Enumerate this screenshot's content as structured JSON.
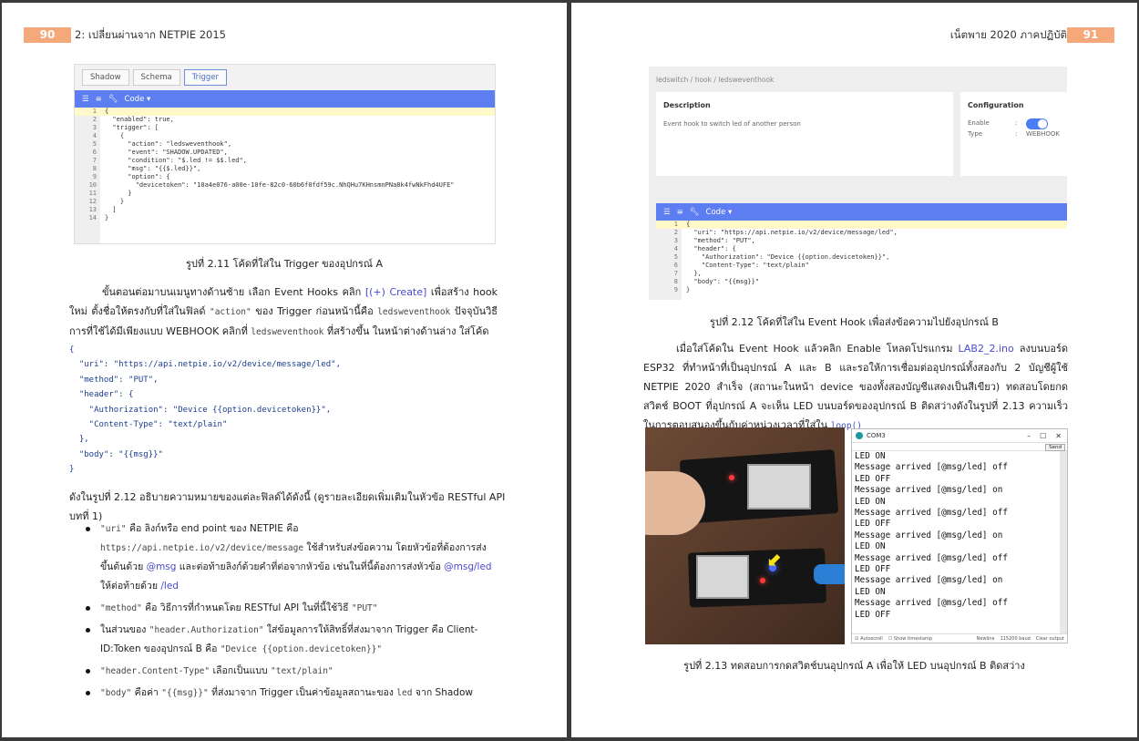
{
  "left": {
    "page_number": "90",
    "header": "2: เปลี่ยนผ่านจาก NETPIE 2015",
    "figure1": {
      "tabs": [
        "Shadow",
        "Schema",
        "Trigger"
      ],
      "toolbar_label": "Code ▾",
      "code_lines": [
        "{",
        "  \"enabled\": true,",
        "  \"trigger\": [",
        "    {",
        "      \"action\": \"ledsweventhook\",",
        "      \"event\": \"SHADOW.UPDATED\",",
        "      \"condition\": \"$.led != $$.led\",",
        "      \"msg\": \"{{$.led}}\",",
        "      \"option\": {",
        "        \"devicetoken\": \"10a4e076-a00e-10fe-82c0-60b6f0fdf59c.NhQHu7KHnsmnPNa8k4fwNkFhd4UFE\"",
        "      }",
        "    }",
        "  ]",
        "}"
      ],
      "caption": "รูปที่ 2.11 โค้ดที่ใส่ใน Trigger ของอุปกรณ์ A"
    },
    "para1": {
      "t1": "ขั้นตอนต่อมาบนเมนูทางด้านซ้าย เลือก Event Hooks คลิก ",
      "t2": "[(+) Create]",
      "t3": " เพื่อสร้าง hook ใหม่ ตั้งชื่อให้ตรงกับที่ใส่ในฟิลด์ ",
      "c1": "\"action\"",
      "t4": " ของ Trigger ก่อนหน้านี้คือ ",
      "c2": "ledsweventhook",
      "t5": " ปัจจุบันวิธีการที่ใช้ได้มีเพียงแบบ WEBHOOK คลิกที่ ",
      "c3": "ledsweventhook",
      "t6": " ที่สร้างขึ้น ในหน้าต่างด้านล่าง ใส่โค้ด"
    },
    "code_block": "{\n  \"uri\": \"https://api.netpie.io/v2/device/message/led\",\n  \"method\": \"PUT\",\n  \"header\": {\n    \"Authorization\": \"Device {{option.devicetoken}}\",\n    \"Content-Type\": \"text/plain\"\n  },\n  \"body\": \"{{msg}}\"\n}",
    "para2": "ดังในรูปที่ 2.12 อธิบายความหมายของแต่ละฟิลด์ได้ดังนี้ (ดูรายละเอียดเพิ่มเติมในหัวข้อ RESTful API บทที่ 1)",
    "bullets": {
      "b1_code": "\"uri\"",
      "b1_t1": " คือ ลิงก์หรือ end point ของ NETPIE คือ ",
      "b1_url": "https://api.netpie.io/v2/device/message",
      "b1_t2": " ใช้สำหรับส่งข้อความ โดยหัวข้อที่ต้องการส่งขึ้นต้นด้วย ",
      "b1_l1": "@msg",
      "b1_t3": " และต่อท้ายลิงก์ด้วยคำที่ต่อจากหัวข้อ เช่นในที่นี้ต้องการส่งหัวข้อ ",
      "b1_l2": "@msg/led",
      "b1_t4": " ให้ต่อท้ายด้วย ",
      "b1_l3": "/led",
      "b2_code": "\"method\"",
      "b2_t1": " คือ วิธีการที่กำหนดโดย RESTful API ในที่นี้ใช้วิธี ",
      "b2_code2": "\"PUT\"",
      "b3_t1": "ในส่วนของ ",
      "b3_code": "\"header.Authorization\"",
      "b3_t2": " ใส่ข้อมูลการให้สิทธิ์ที่ส่งมาจาก Trigger คือ Client-ID:Token ของอุปกรณ์ B คือ ",
      "b3_code2": "\"Device {{option.devicetoken}}\"",
      "b4_code": "\"header.Content-Type\"",
      "b4_t1": " เลือกเป็นแบบ ",
      "b4_code2": "\"text/plain\"",
      "b5_code": "\"body\"",
      "b5_t1": " คือค่า ",
      "b5_code2": "\"{{msg}}\"",
      "b5_t2": " ที่ส่งมาจาก Trigger เป็นค่าข้อมูลสถานะของ ",
      "b5_code3": "led",
      "b5_t3": " จาก Shadow"
    }
  },
  "right": {
    "page_number": "91",
    "header": "เน็ตพาย 2020 ภาคปฏิบัติ",
    "figure2": {
      "breadcrumb": "ledswitch  /  hook  /  ledsweventhook",
      "desc_title": "Description",
      "desc_text": "Event hook to switch led of another person",
      "cfg_title": "Configuration",
      "enable_label": "Enable",
      "type_label": "Type",
      "colon": ":",
      "type_value": "WEBHOOK",
      "toolbar_label": "Code ▾",
      "code_lines": [
        "{",
        "  \"uri\": \"https://api.netpie.io/v2/device/message/led\",",
        "  \"method\": \"PUT\",",
        "  \"header\": {",
        "    \"Authorization\": \"Device {{option.devicetoken}}\",",
        "    \"Content-Type\": \"text/plain\"",
        "  },",
        "  \"body\": \"{{msg}}\"",
        "}"
      ],
      "caption": "รูปที่ 2.12 โค้ดที่ใส่ใน Event Hook เพื่อส่งข้อความไปยังอุปกรณ์ B"
    },
    "para": {
      "t1": "เมื่อใส่โค้ดใน Event Hook แล้วคลิก Enable โหลดโปรแกรม ",
      "link": "LAB2_2.ino",
      "t2": " ลงบนบอร์ด ESP32 ที่ทำหน้าที่เป็นอุปกรณ์ A และ B และรอให้การเชื่อมต่ออุปกรณ์ทั้งสองกับ 2 บัญชีผู้ใช้ NETPIE 2020 สำเร็จ (สถานะในหน้า device ของทั้งสองบัญชีแสดงเป็นสีเขียว) ทดสอบโดยกดสวิตช์ BOOT ที่อุปกรณ์ A จะเห็น LED บนบอร์ดของอุปกรณ์ B ติดสว่างดังในรูปที่ 2.13 ความเร็วในการตอบสนองขึ้นกับค่าหน่วงเวลาที่ใส่ใน ",
      "code": "loop()"
    },
    "figure3": {
      "serial_title": "COM3",
      "send_label": "Send",
      "log": [
        "LED ON",
        "Message arrived [@msg/led] off",
        "LED OFF",
        "Message arrived [@msg/led] on",
        "LED ON",
        "Message arrived [@msg/led] off",
        "LED OFF",
        "Message arrived [@msg/led] on",
        "LED ON",
        "Message arrived [@msg/led] off",
        "LED OFF",
        "Message arrived [@msg/led] on",
        "LED ON",
        "Message arrived [@msg/led] off",
        "LED OFF"
      ],
      "autoscroll": "Autoscroll",
      "timestamp": "Show timestamp",
      "newline": "Newline",
      "baud": "115200 baud",
      "clear": "Clear output",
      "caption": "รูปที่ 2.13 ทดสอบการกดสวิตช์บนอุปกรณ์ A เพื่อให้ LED บนอุปกรณ์ B ติดสว่าง"
    }
  }
}
